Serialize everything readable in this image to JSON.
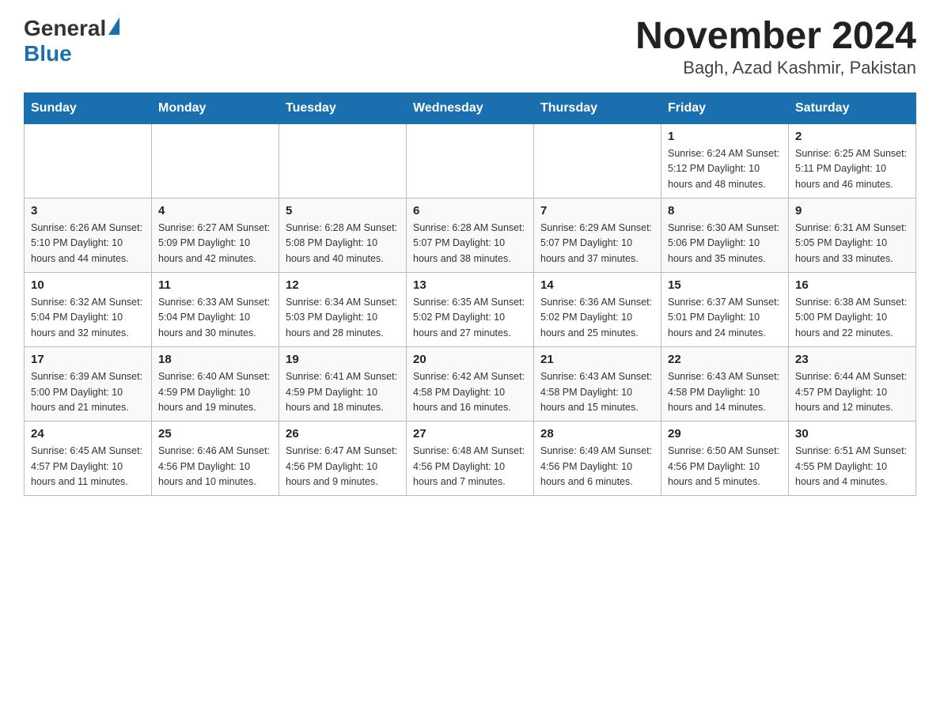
{
  "header": {
    "logo_general": "General",
    "logo_blue": "Blue",
    "title": "November 2024",
    "subtitle": "Bagh, Azad Kashmir, Pakistan"
  },
  "weekdays": [
    "Sunday",
    "Monday",
    "Tuesday",
    "Wednesday",
    "Thursday",
    "Friday",
    "Saturday"
  ],
  "weeks": [
    [
      {
        "day": "",
        "info": ""
      },
      {
        "day": "",
        "info": ""
      },
      {
        "day": "",
        "info": ""
      },
      {
        "day": "",
        "info": ""
      },
      {
        "day": "",
        "info": ""
      },
      {
        "day": "1",
        "info": "Sunrise: 6:24 AM\nSunset: 5:12 PM\nDaylight: 10 hours and 48 minutes."
      },
      {
        "day": "2",
        "info": "Sunrise: 6:25 AM\nSunset: 5:11 PM\nDaylight: 10 hours and 46 minutes."
      }
    ],
    [
      {
        "day": "3",
        "info": "Sunrise: 6:26 AM\nSunset: 5:10 PM\nDaylight: 10 hours and 44 minutes."
      },
      {
        "day": "4",
        "info": "Sunrise: 6:27 AM\nSunset: 5:09 PM\nDaylight: 10 hours and 42 minutes."
      },
      {
        "day": "5",
        "info": "Sunrise: 6:28 AM\nSunset: 5:08 PM\nDaylight: 10 hours and 40 minutes."
      },
      {
        "day": "6",
        "info": "Sunrise: 6:28 AM\nSunset: 5:07 PM\nDaylight: 10 hours and 38 minutes."
      },
      {
        "day": "7",
        "info": "Sunrise: 6:29 AM\nSunset: 5:07 PM\nDaylight: 10 hours and 37 minutes."
      },
      {
        "day": "8",
        "info": "Sunrise: 6:30 AM\nSunset: 5:06 PM\nDaylight: 10 hours and 35 minutes."
      },
      {
        "day": "9",
        "info": "Sunrise: 6:31 AM\nSunset: 5:05 PM\nDaylight: 10 hours and 33 minutes."
      }
    ],
    [
      {
        "day": "10",
        "info": "Sunrise: 6:32 AM\nSunset: 5:04 PM\nDaylight: 10 hours and 32 minutes."
      },
      {
        "day": "11",
        "info": "Sunrise: 6:33 AM\nSunset: 5:04 PM\nDaylight: 10 hours and 30 minutes."
      },
      {
        "day": "12",
        "info": "Sunrise: 6:34 AM\nSunset: 5:03 PM\nDaylight: 10 hours and 28 minutes."
      },
      {
        "day": "13",
        "info": "Sunrise: 6:35 AM\nSunset: 5:02 PM\nDaylight: 10 hours and 27 minutes."
      },
      {
        "day": "14",
        "info": "Sunrise: 6:36 AM\nSunset: 5:02 PM\nDaylight: 10 hours and 25 minutes."
      },
      {
        "day": "15",
        "info": "Sunrise: 6:37 AM\nSunset: 5:01 PM\nDaylight: 10 hours and 24 minutes."
      },
      {
        "day": "16",
        "info": "Sunrise: 6:38 AM\nSunset: 5:00 PM\nDaylight: 10 hours and 22 minutes."
      }
    ],
    [
      {
        "day": "17",
        "info": "Sunrise: 6:39 AM\nSunset: 5:00 PM\nDaylight: 10 hours and 21 minutes."
      },
      {
        "day": "18",
        "info": "Sunrise: 6:40 AM\nSunset: 4:59 PM\nDaylight: 10 hours and 19 minutes."
      },
      {
        "day": "19",
        "info": "Sunrise: 6:41 AM\nSunset: 4:59 PM\nDaylight: 10 hours and 18 minutes."
      },
      {
        "day": "20",
        "info": "Sunrise: 6:42 AM\nSunset: 4:58 PM\nDaylight: 10 hours and 16 minutes."
      },
      {
        "day": "21",
        "info": "Sunrise: 6:43 AM\nSunset: 4:58 PM\nDaylight: 10 hours and 15 minutes."
      },
      {
        "day": "22",
        "info": "Sunrise: 6:43 AM\nSunset: 4:58 PM\nDaylight: 10 hours and 14 minutes."
      },
      {
        "day": "23",
        "info": "Sunrise: 6:44 AM\nSunset: 4:57 PM\nDaylight: 10 hours and 12 minutes."
      }
    ],
    [
      {
        "day": "24",
        "info": "Sunrise: 6:45 AM\nSunset: 4:57 PM\nDaylight: 10 hours and 11 minutes."
      },
      {
        "day": "25",
        "info": "Sunrise: 6:46 AM\nSunset: 4:56 PM\nDaylight: 10 hours and 10 minutes."
      },
      {
        "day": "26",
        "info": "Sunrise: 6:47 AM\nSunset: 4:56 PM\nDaylight: 10 hours and 9 minutes."
      },
      {
        "day": "27",
        "info": "Sunrise: 6:48 AM\nSunset: 4:56 PM\nDaylight: 10 hours and 7 minutes."
      },
      {
        "day": "28",
        "info": "Sunrise: 6:49 AM\nSunset: 4:56 PM\nDaylight: 10 hours and 6 minutes."
      },
      {
        "day": "29",
        "info": "Sunrise: 6:50 AM\nSunset: 4:56 PM\nDaylight: 10 hours and 5 minutes."
      },
      {
        "day": "30",
        "info": "Sunrise: 6:51 AM\nSunset: 4:55 PM\nDaylight: 10 hours and 4 minutes."
      }
    ]
  ]
}
